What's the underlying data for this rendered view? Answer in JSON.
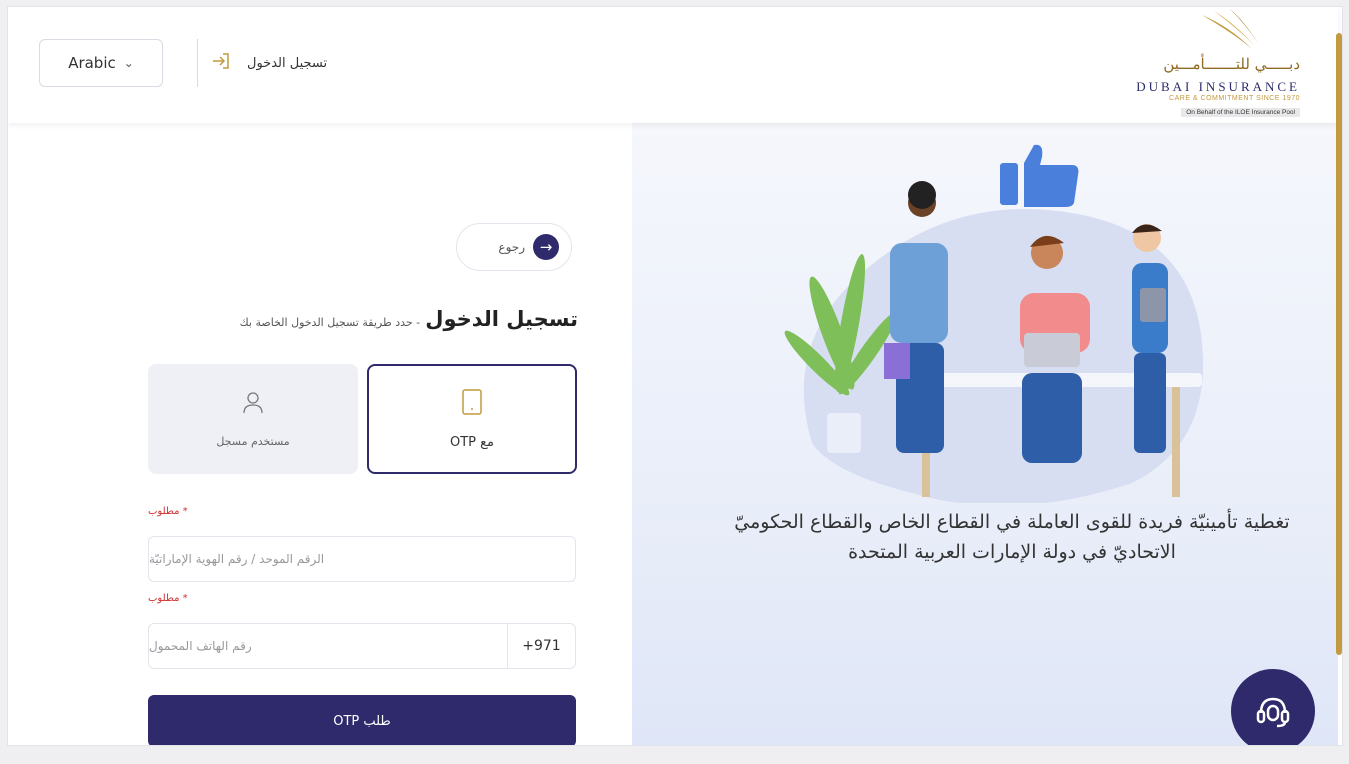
{
  "header": {
    "language": "Arabic",
    "login_link": "تسجيل الدخول",
    "logo": {
      "arabic": "دبـــــي للتـــــــأمـــين",
      "english": "DUBAI INSURANCE",
      "tagline": "CARE & COMMITMENT SINCE 1970",
      "pool": "On Behalf of the ILOE Insurance Pool"
    }
  },
  "form": {
    "back_label": "رجوع",
    "title": "تسجيل الدخول",
    "subtitle": "حدد طريقة تسجيل الدخول الخاصة بك",
    "options": [
      {
        "label": "مع OTP",
        "icon": "tablet-icon"
      },
      {
        "label": "مستخدم مسجل",
        "icon": "user-icon"
      }
    ],
    "required_label": "* مطلوب",
    "id_placeholder": "الرقم الموحد / رقم الهوية الإماراتيّة",
    "phone_code": "+971",
    "phone_placeholder": "رقم الهاتف المحمول",
    "submit_label": "طلب OTP"
  },
  "promo": {
    "tagline": "تغطية تأمينيّة فريدة للقوى العاملة في القطاع الخاص والقطاع الحكوميّ الاتحاديّ في دولة الإمارات العربية المتحدة"
  },
  "colors": {
    "primary": "#2f2a6b",
    "gold": "#c39a3f",
    "required": "#d03030"
  },
  "icons": {
    "support": "headset-icon",
    "login": "sign-in-icon",
    "back": "arrow-right-icon"
  }
}
